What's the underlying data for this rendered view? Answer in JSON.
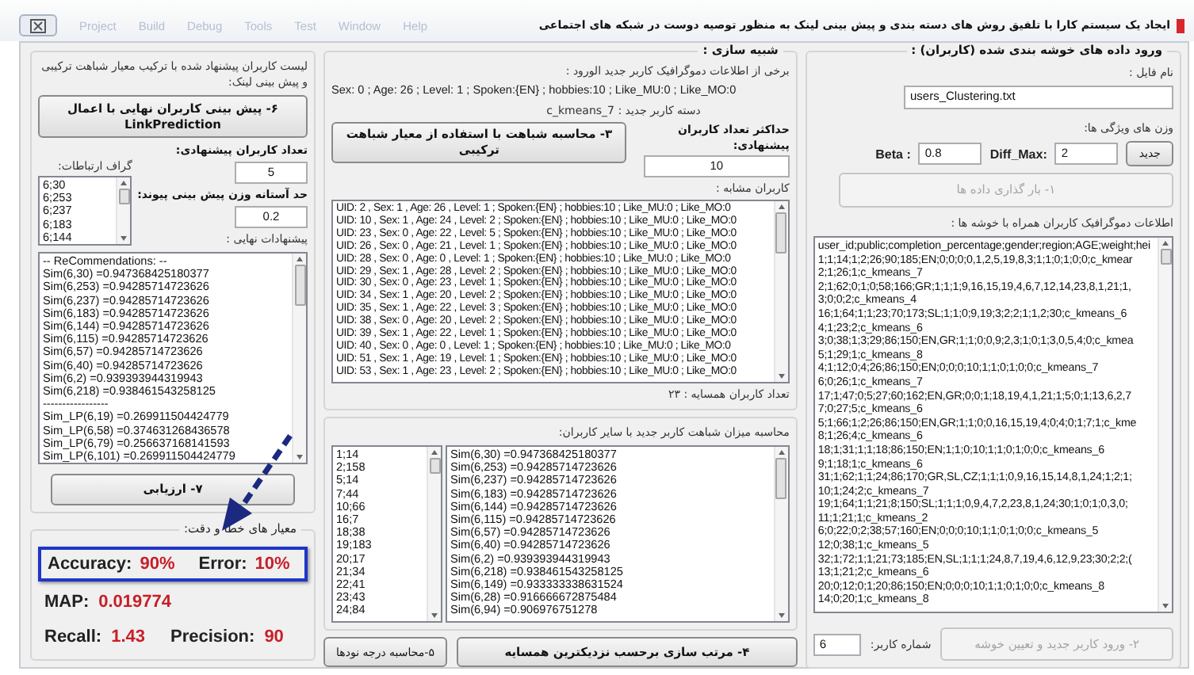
{
  "window": {
    "menu": [
      "Project",
      "Build",
      "Debug",
      "Tools",
      "Test",
      "Window",
      "Help"
    ],
    "title": "ایجاد یک سیستم کارا با تلفیق روش های دسته بندی و پیش بینی لینک به منظور توصیه دوست در شبکه های اجتماعی"
  },
  "recommendation_panel": {
    "heading": "لیست کاربران پیشنهاد شده با ترکیب معیار شباهت ترکیبی و پیش بینی لینک:",
    "predict_button": {
      "label": "۶- پیش بینی کاربران نهایی با اعمال LinkPrediction",
      "disabled": false
    },
    "suggested_count": {
      "label": "تعداد کاربران پیشنهادی:",
      "value": "5"
    },
    "graph": {
      "label": "گراف ارتباطات:",
      "items": [
        "6;30",
        "6;253",
        "6;237",
        "6;183",
        "6;144"
      ]
    },
    "threshold": {
      "label": "حد آستانه وزن پیش بینی پیوند:",
      "value": "0.2"
    },
    "final": {
      "label": "پیشنهادات نهایی :",
      "items": [
        "-- ReCommendations: --",
        "Sim(6,30) =0.947368425180377",
        "Sim(6,253) =0.94285714723626",
        "Sim(6,237) =0.94285714723626",
        "Sim(6,183) =0.94285714723626",
        "Sim(6,144) =0.94285714723626",
        "Sim(6,115) =0.94285714723626",
        "Sim(6,57) =0.94285714723626",
        "Sim(6,40) =0.94285714723626",
        "Sim(6,2) =0.939393944319943",
        "Sim(6,218) =0.938461543258125",
        "-----------------",
        "Sim_LP(6,19) =0.269911504424779",
        "Sim_LP(6,58) =0.374631268436578",
        "Sim_LP(6,79) =0.256637168141593",
        "Sim_LP(6,101) =0.269911504424779"
      ]
    },
    "evaluate_button": {
      "label": "۷- ارزیابی",
      "disabled": false
    },
    "metrics": {
      "legend": "معیار های خطا و دقت:",
      "rows": [
        {
          "highlighted": true,
          "items": [
            {
              "label": "Accuracy:",
              "value": "90%"
            },
            {
              "label": "Error:",
              "value": "10%"
            }
          ]
        },
        {
          "highlighted": false,
          "items": [
            {
              "label": "MAP:",
              "value": "0.019774"
            }
          ]
        },
        {
          "highlighted": false,
          "items": [
            {
              "label": "Recall:",
              "value": "1.43"
            },
            {
              "label": "Precision:",
              "value": "90"
            }
          ]
        }
      ]
    }
  },
  "simulation_panel": {
    "legend": "شبیه سازی :",
    "demographics_label": "برخی از اطلاعات دموگرافیک کاربر جدید الورود :",
    "demographics": "Sex: 0 ; Age: 26 ; Level: 1 ; Spoken:{EN} ; hobbies:10 ; Like_MU:0 ; Like_MO:0",
    "category": "دسته کاربر جدید : c_kmeans_7",
    "similarity_button": {
      "label": "۳- محاسبه شباهت با استفاده از معیار شباهت ترکیبی",
      "disabled": false
    },
    "max_suggested": {
      "label": "حداکثر تعداد کاربران پیشنهادی:",
      "value": "10"
    },
    "similar_users": {
      "label": "کاربران مشابه :",
      "items": [
        "UID: 2 , Sex: 1 , Age: 26 , Level: 1 ; Spoken:{EN} ; hobbies:10 ; Like_MU:0 ; Like_MO:0",
        "UID: 10 , Sex: 1 , Age: 24 , Level: 2 ; Spoken:{EN} ; hobbies:10 ; Like_MU:0 ; Like_MO:0",
        "UID: 23 , Sex: 0 , Age: 22 , Level: 5 ; Spoken:{EN} ; hobbies:10 ; Like_MU:0 ; Like_MO:0",
        "UID: 26 , Sex: 0 , Age: 21 , Level: 1 ; Spoken:{EN} ; hobbies:10 ; Like_MU:0 ; Like_MO:0",
        "UID: 28 , Sex: 0 , Age: 0 , Level: 1 ; Spoken:{EN} ; hobbies:10 ; Like_MU:0 ; Like_MO:0",
        "UID: 29 , Sex: 1 , Age: 28 , Level: 2 ; Spoken:{EN} ; hobbies:10 ; Like_MU:0 ; Like_MO:0",
        "UID: 30 , Sex: 0 , Age: 23 , Level: 1 ; Spoken:{EN} ; hobbies:10 ; Like_MU:0 ; Like_MO:0",
        "UID: 34 , Sex: 1 , Age: 20 , Level: 2 ; Spoken:{EN} ; hobbies:10 ; Like_MU:0 ; Like_MO:0",
        "UID: 35 , Sex: 1 , Age: 22 , Level: 3 ; Spoken:{EN} ; hobbies:10 ; Like_MU:0 ; Like_MO:0",
        "UID: 38 , Sex: 0 , Age: 20 , Level: 2 ; Spoken:{EN} ; hobbies:10 ; Like_MU:0 ; Like_MO:0",
        "UID: 39 , Sex: 1 , Age: 22 , Level: 1 ; Spoken:{EN} ; hobbies:10 ; Like_MU:0 ; Like_MO:0",
        "UID: 40 , Sex: 0 , Age: 0 , Level: 1 ; Spoken:{EN} ; hobbies:10 ; Like_MU:0 ; Like_MO:0",
        "UID: 51 , Sex: 1 , Age: 19 , Level: 1 ; Spoken:{EN} ; hobbies:10 ; Like_MU:0 ; Like_MO:0",
        "UID: 53 , Sex: 1 , Age: 23 , Level: 2 ; Spoken:{EN} ; hobbies:10 ; Like_MU:0 ; Like_MO:0"
      ]
    },
    "neighbor_count": "تعداد کاربران همسایه :   ۲۳"
  },
  "similarity_panel": {
    "heading": "محاسبه میزان شباهت کاربر جدید با سایر کاربران:",
    "degrees": [
      "1;14",
      "2;158",
      "5;14",
      "7;44",
      "10;66",
      "16;7",
      "18;38",
      "19;183",
      "20;17",
      "21;34",
      "22;41",
      "23;43",
      "24;84"
    ],
    "similarities": [
      "Sim(6,30) =0.947368425180377",
      "Sim(6,253) =0.94285714723626",
      "Sim(6,237) =0.94285714723626",
      "Sim(6,183) =0.94285714723626",
      "Sim(6,144) =0.94285714723626",
      "Sim(6,115) =0.94285714723626",
      "Sim(6,57) =0.94285714723626",
      "Sim(6,40) =0.94285714723626",
      "Sim(6,2) =0.939393944319943",
      "Sim(6,218) =0.938461543258125",
      "Sim(6,149) =0.933333338631524",
      "Sim(6,28) =0.916666672875484",
      "Sim(6,94) =0.906976751278"
    ],
    "degree_button": {
      "label": "۵-محاسبه درجه نودها",
      "disabled": false
    },
    "sort_button": {
      "label": "۴- مرتب سازی برحسب نزدیکترین همسایه",
      "disabled": false
    }
  },
  "data_panel": {
    "legend": "ورود داده های خوشه بندی شده (کاربران) :",
    "file": {
      "label": "نام فایل :",
      "value": "users_Clustering.txt"
    },
    "weights_label": "وزن های ویژگی ها:",
    "beta": {
      "label": "Beta :",
      "value": "0.8"
    },
    "diff_max": {
      "label": "Diff_Max:",
      "value": "2"
    },
    "new_button": {
      "label": "جدید",
      "disabled": false
    },
    "load_button": {
      "label": "۱- بار گذاری داده ها",
      "disabled": true
    },
    "records": {
      "label": "اطلاعات دموگرافیک کاربران همراه با خوشه ها :",
      "lines": [
        "user_id;public;completion_percentage;gender;region;AGE;weight;hei",
        "1;1;14;1;2;26;90;185;EN;0;0;0;0,1,2,5,19,8,3;1;1;0;1;0;0;c_kmear",
        "2;1;26;1;c_kmeans_7",
        "2;1;62;0;1;0;58;166;GR;1;1;1;9,16,15,19,4,6,7,12,14,23,8,1,21;1,",
        "3;0;0;2;c_kmeans_4",
        "16;1;64;1;1;23;70;173;SL;1;1;0;9,19;3;2;2;1;1,2;30;c_kmeans_6",
        "4;1;23;2;c_kmeans_6",
        "3;0;38;1;3;29;86;150;EN,GR;1;1;0;0,9;2,3;1;0;1;3,0,5,4;0;c_kmea",
        "5;1;29;1;c_kmeans_8",
        "4;1;12;0;4;26;86;150;EN;0;0;0;10;1;1;0;1;0;0;c_kmeans_7",
        "6;0;26;1;c_kmeans_7",
        "17;1;47;0;5;27;60;162;EN,GR;0;0;1;18,19,4,1,21;1;5;0;1;13,6,2,7",
        "7;0;27;5;c_kmeans_6",
        "5;1;66;1;2;26;86;150;EN,GR;1;1;0;0,16,15,19,4;0;4;0;1;7;1;c_kme",
        "8;1;26;4;c_kmeans_6",
        "18;1;31;1;1;18;86;150;EN;1;1;0;10;1;1;0;1;0;0;c_kmeans_6",
        "9;1;18;1;c_kmeans_6",
        "31;1;62;1;1;24;86;170;GR,SL,CZ;1;1;1;0,9,16,15,14,8,1,24;1;2;1;",
        "10;1;24;2;c_kmeans_7",
        "19;1;64;1;1;21;8;150;SL;1;1;1;0,9,4,7,2,23,8,1,24;30;1;0;1;0,3,0;",
        "11;1;21;1;c_kmeans_2",
        "6;0;22;0;2;38;57;160;EN;0;0;0;10;1;1;0;1;0;0;c_kmeans_5",
        "12;0;38;1;c_kmeans_5",
        "32;1;72;1;1;21;73;185;EN,SL;1;1;1;24,8,7,19,4,6,12,9,23;30;2;2;(",
        "13;1;21;2;c_kmeans_6",
        "20;0;12;0;1;20;86;150;EN;0;0;0;10;1;1;0;1;0;0;c_kmeans_8",
        "14;0;20;1;c_kmeans_8"
      ]
    },
    "assign_button": {
      "label": "۲- ورود کاربر جدید و تعیین خوشه",
      "disabled": true
    },
    "user_number": {
      "label": "شماره کاربر:",
      "value": "6"
    }
  }
}
